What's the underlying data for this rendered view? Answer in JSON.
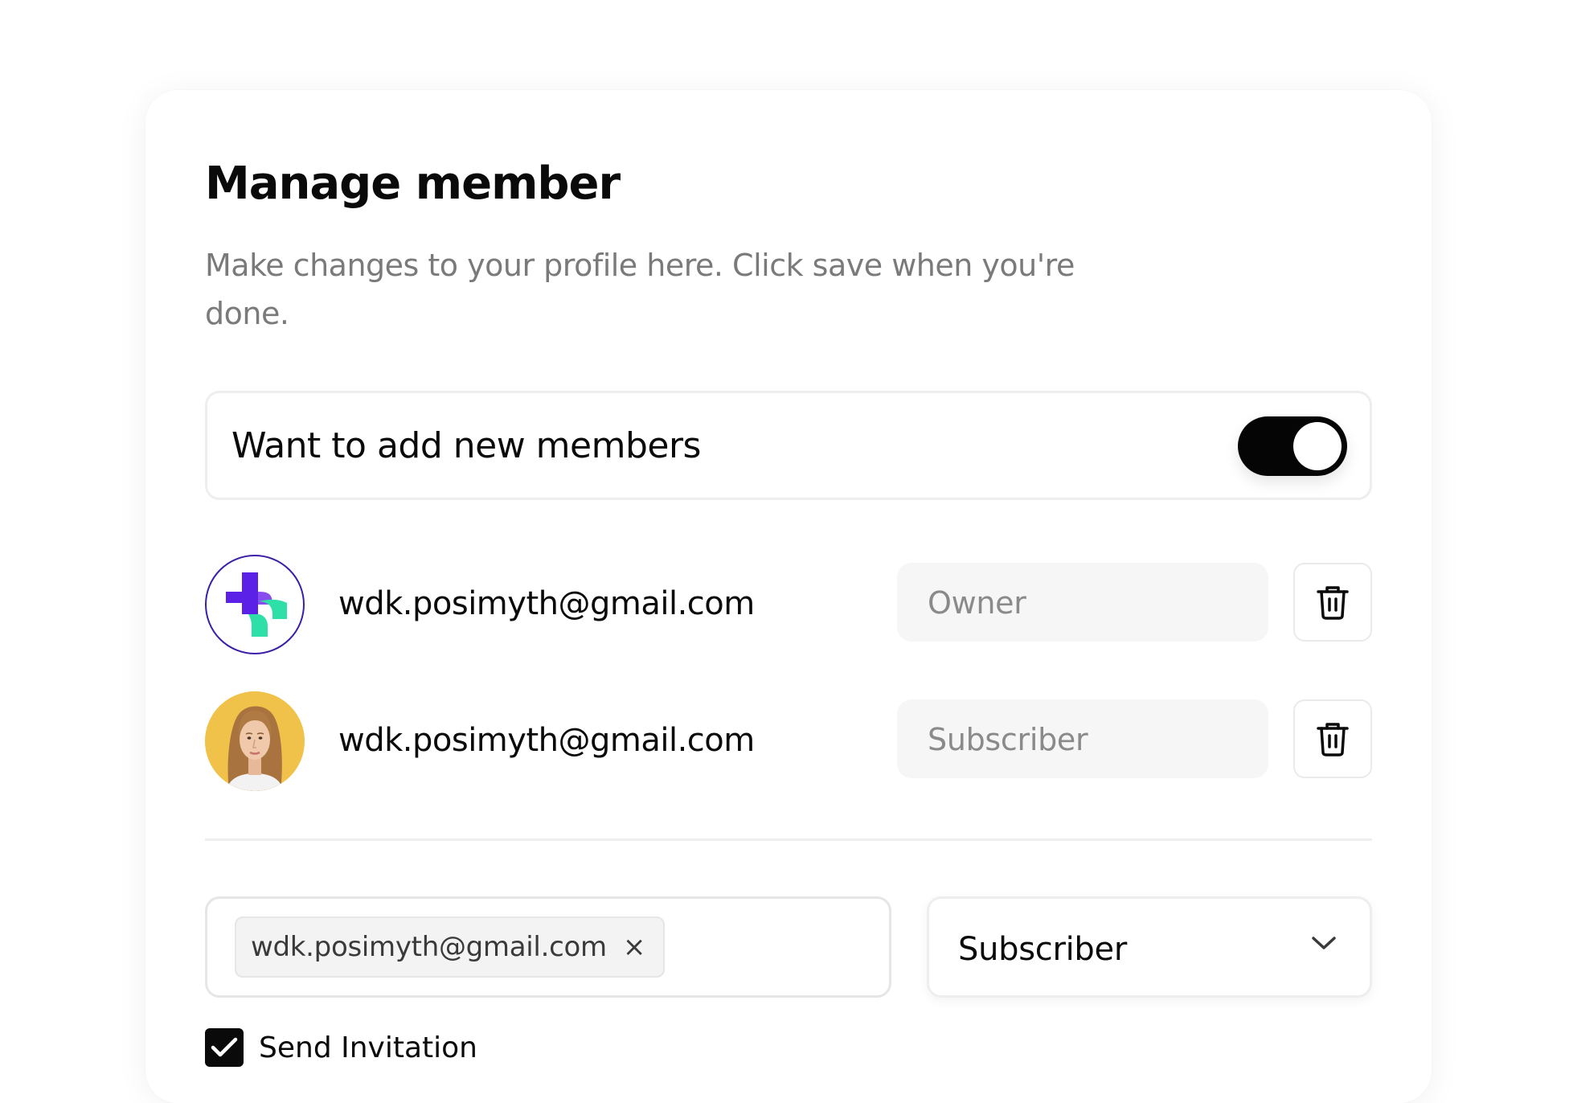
{
  "dialog": {
    "title": "Manage member",
    "description": "Make changes to your profile here. Click save when you're done."
  },
  "toggle_row": {
    "label": "Want to add new members",
    "enabled": true
  },
  "members": [
    {
      "email": "wdk.posimyth@gmail.com",
      "role": "Owner",
      "avatar": "brand-logo-icon"
    },
    {
      "email": "wdk.posimyth@gmail.com",
      "role": "Subscriber",
      "avatar": "user-photo"
    }
  ],
  "invite": {
    "chip_email": "wdk.posimyth@gmail.com",
    "chip_remove_symbol": "×",
    "selected_role": "Subscriber",
    "send_invitation_label": "Send Invitation",
    "send_invitation_checked": true
  },
  "colors": {
    "toggle_on": "#050505",
    "logo_purple": "#5b21e6",
    "logo_teal": "#2ee0a8",
    "avatar_bg": "#f1c24a",
    "muted_text": "#7a7a7a"
  }
}
